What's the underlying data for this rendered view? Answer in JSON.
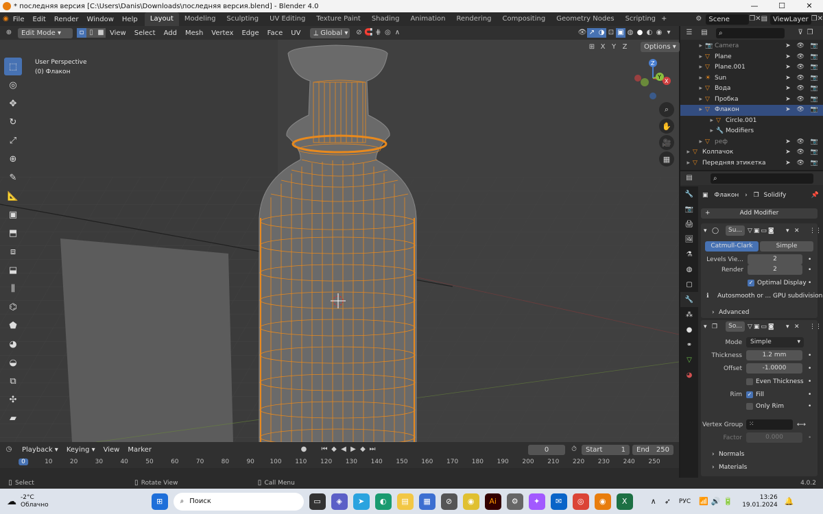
{
  "titlebar": {
    "title": "* последняя версия [C:\\Users\\Danis\\Downloads\\последняя версия.blend] - Blender 4.0",
    "min": "—",
    "max": "☐",
    "close": "✕"
  },
  "menu": [
    "File",
    "Edit",
    "Render",
    "Window",
    "Help"
  ],
  "workspaces": [
    "Layout",
    "Modeling",
    "Sculpting",
    "UV Editing",
    "Texture Paint",
    "Shading",
    "Animation",
    "Rendering",
    "Compositing",
    "Geometry Nodes",
    "Scripting"
  ],
  "scene": "Scene",
  "viewlayer": "ViewLayer",
  "vpheader": {
    "mode": "Edit Mode",
    "menus": [
      "View",
      "Select",
      "Add",
      "Mesh",
      "Vertex",
      "Edge",
      "Face",
      "UV"
    ],
    "orientation": "Global",
    "options": "Options",
    "axes": [
      "X",
      "Y",
      "Z"
    ]
  },
  "viewport": {
    "view_name": "User Perspective",
    "object_label": "(0) Флакон"
  },
  "gizmo": {
    "x": "X",
    "y": "Y",
    "z": "Z"
  },
  "outliner": {
    "search_placeholder": "",
    "rows": [
      {
        "name": "Camera",
        "dim": true
      },
      {
        "name": "Plane"
      },
      {
        "name": "Plane.001"
      },
      {
        "name": "Sun"
      },
      {
        "name": "Вода"
      },
      {
        "name": "Пробка"
      },
      {
        "name": "Флакон",
        "sel": true
      },
      {
        "name": "Circle.001",
        "child": true
      },
      {
        "name": "Modifiers",
        "child": true
      },
      {
        "name": "реф",
        "dim": true
      },
      {
        "name": "Колпачок"
      },
      {
        "name": "Передняя этикетка"
      }
    ]
  },
  "props": {
    "breadcrumb_obj": "Флакон",
    "breadcrumb_mod": "Solidify",
    "add_modifier": "Add Modifier",
    "subsurf": {
      "name": "Su...",
      "tab1": "Catmull-Clark",
      "tab2": "Simple",
      "levels_label": "Levels Vie...",
      "levels": "2",
      "render_label": "Render",
      "render": "2",
      "optimal": "Optimal Display",
      "gpu_note": "Autosmooth or ... GPU subdivision",
      "advanced": "Advanced"
    },
    "solidify": {
      "name": "So...",
      "mode_label": "Mode",
      "mode": "Simple",
      "thickness_label": "Thickness",
      "thickness": "1.2 mm",
      "offset_label": "Offset",
      "offset": "-1.0000",
      "even": "Even Thickness",
      "rim_label": "Rim",
      "fill": "Fill",
      "only_rim": "Only Rim",
      "vgroup_label": "Vertex Group",
      "factor_label": "Factor",
      "factor": "0.000",
      "normals": "Normals",
      "materials": "Materials"
    }
  },
  "timeline": {
    "menus": [
      "Playback",
      "Keying",
      "View",
      "Marker"
    ],
    "current": "0",
    "start_label": "Start",
    "start": "1",
    "end_label": "End",
    "end": "250",
    "ticks": [
      "0",
      "10",
      "20",
      "30",
      "40",
      "50",
      "60",
      "70",
      "80",
      "90",
      "100",
      "110",
      "120",
      "130",
      "140",
      "150",
      "160",
      "170",
      "180",
      "190",
      "200",
      "210",
      "220",
      "230",
      "240",
      "250"
    ]
  },
  "status": {
    "select": "Select",
    "rotate": "Rotate View",
    "menu": "Call Menu",
    "version": "4.0.2"
  },
  "taskbar": {
    "temp": "-2°C",
    "weather": "Облачно",
    "search": "Поиск",
    "lang": "РУС",
    "time": "13:26",
    "date": "19.01.2024"
  }
}
